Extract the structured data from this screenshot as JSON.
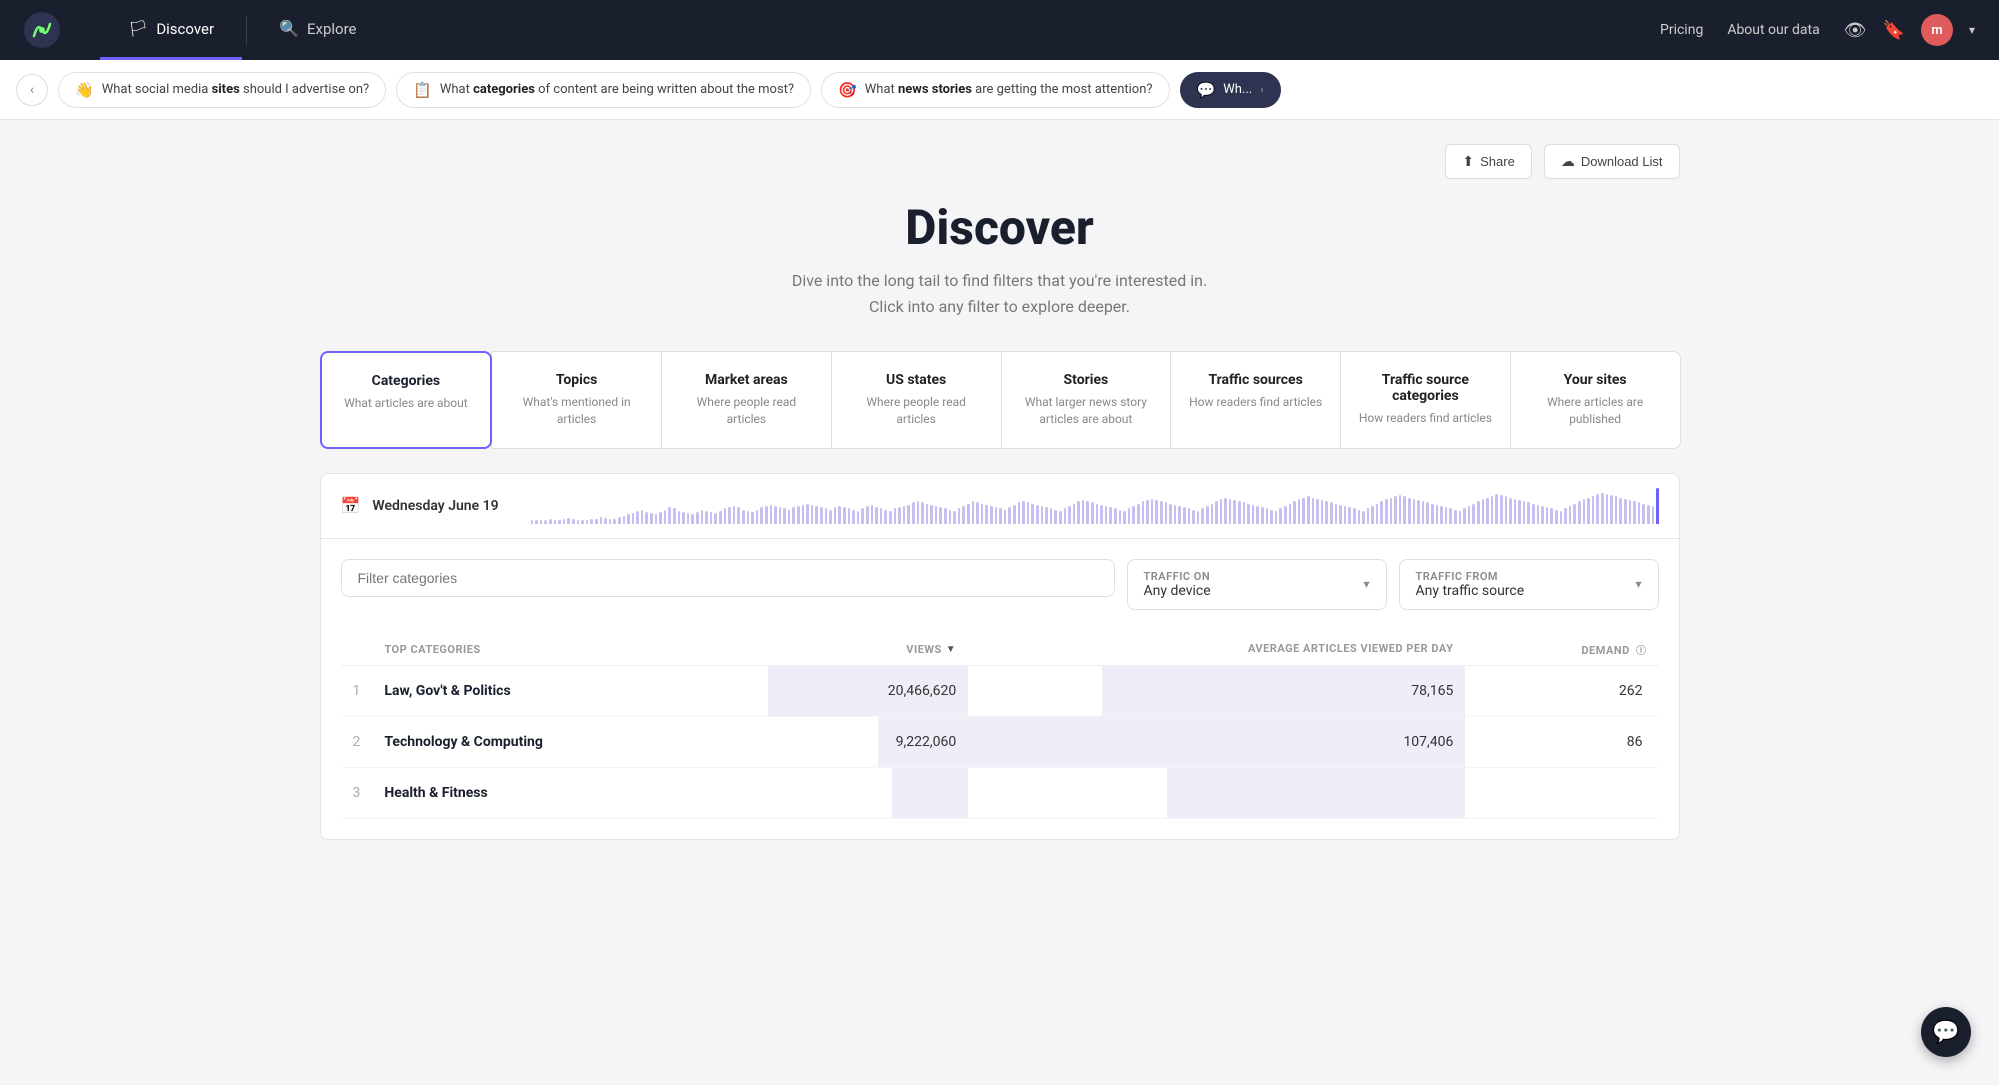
{
  "navbar": {
    "logo_alt": "Chartbeat Logo",
    "nav_items": [
      {
        "label": "Discover",
        "icon": "🏳",
        "active": true
      },
      {
        "label": "Explore",
        "icon": "🔍",
        "active": false
      }
    ],
    "right_links": [
      {
        "label": "Pricing",
        "key": "pricing"
      },
      {
        "label": "About our data",
        "key": "about"
      }
    ],
    "avatar_initial": "m"
  },
  "suggestion_bar": {
    "back_icon": "‹",
    "pills": [
      {
        "icon": "👋",
        "text_parts": [
          "What social media ",
          "sites",
          " should I advertise on?"
        ]
      },
      {
        "icon": "📋",
        "text_parts": [
          "What ",
          "categories",
          " of content are being written about the most?"
        ]
      },
      {
        "icon": "🎯",
        "text_parts": [
          "What ",
          "news stories",
          " are getting the most attention?"
        ]
      },
      {
        "icon": "💬",
        "text_parts": [
          "Wh..."
        ]
      }
    ]
  },
  "top_actions": {
    "share_label": "Share",
    "download_label": "Download List"
  },
  "page_header": {
    "title": "Discover",
    "subtitle_line1": "Dive into the long tail to find filters that you're interested in.",
    "subtitle_line2": "Click into any filter to explore deeper."
  },
  "filter_tabs": [
    {
      "title": "Categories",
      "desc": "What articles are about",
      "active": true
    },
    {
      "title": "Topics",
      "desc": "What's mentioned in articles",
      "active": false
    },
    {
      "title": "Market areas",
      "desc": "Where people read articles",
      "active": false
    },
    {
      "title": "US states",
      "desc": "Where people read articles",
      "active": false
    },
    {
      "title": "Stories",
      "desc": "What larger news story articles are about",
      "active": false
    },
    {
      "title": "Traffic sources",
      "desc": "How readers find articles",
      "active": false
    },
    {
      "title": "Traffic source categories",
      "desc": "How readers find articles",
      "active": false
    },
    {
      "title": "Your sites",
      "desc": "Where articles are published",
      "active": false
    }
  ],
  "date_bar": {
    "icon": "📅",
    "label": "Wednesday June 19"
  },
  "chart": {
    "bars": [
      4,
      6,
      5,
      7,
      8,
      6,
      5,
      9,
      10,
      8,
      7,
      6,
      5,
      8,
      9,
      11,
      10,
      9,
      8,
      12,
      14,
      16,
      18,
      22,
      24,
      20,
      18,
      16,
      20,
      24,
      28,
      26,
      22,
      20,
      18,
      16,
      20,
      24,
      22,
      20,
      18,
      22,
      26,
      28,
      30,
      28,
      24,
      22,
      20,
      24,
      28,
      30,
      32,
      30,
      28,
      26,
      24,
      28,
      30,
      32,
      34,
      32,
      30,
      28,
      26,
      24,
      28,
      30,
      28,
      26,
      24,
      22,
      26,
      30,
      32,
      28,
      26,
      24,
      22,
      26,
      28,
      30,
      32,
      36,
      38,
      36,
      34,
      32,
      30,
      28,
      26,
      24,
      22,
      26,
      30,
      34,
      38,
      36,
      34,
      32,
      30,
      28,
      26,
      24,
      28,
      32,
      36,
      38,
      36,
      34,
      32,
      30,
      28,
      26,
      24,
      22,
      26,
      30,
      34,
      38,
      40,
      38,
      36,
      34,
      32,
      30,
      28,
      26,
      24,
      22,
      26,
      30,
      34,
      38,
      40,
      42,
      40,
      38,
      36,
      34,
      32,
      30,
      28,
      26,
      24,
      22,
      26,
      30,
      34,
      38,
      42,
      44,
      42,
      40,
      38,
      36,
      34,
      32,
      30,
      28,
      26,
      24,
      22,
      26,
      30,
      34,
      38,
      42,
      44,
      46,
      44,
      42,
      40,
      38,
      36,
      34,
      32,
      30,
      28,
      26,
      24,
      22,
      26,
      30,
      34,
      38,
      42,
      44,
      46,
      48,
      46,
      44,
      42,
      40,
      38,
      36,
      34,
      32,
      30,
      28,
      26,
      24,
      22,
      26,
      30,
      34,
      38,
      42,
      44,
      46,
      50,
      48,
      46,
      44,
      42,
      40,
      38,
      36,
      34,
      32,
      30,
      28,
      26,
      24,
      22,
      26,
      30,
      34,
      38,
      42,
      44,
      46,
      50,
      52,
      50,
      48,
      46,
      44,
      42,
      40,
      38,
      36,
      34,
      32,
      30,
      60
    ]
  },
  "filters": {
    "input_placeholder": "Filter categories",
    "traffic_on_label": "TRAFFIC ON",
    "traffic_on_value": "Any device",
    "traffic_from_label": "TRAFFIC FROM",
    "traffic_from_value": "Any traffic source"
  },
  "table": {
    "headers": {
      "category": "TOP CATEGORIES",
      "views": "VIEWS",
      "avg_articles": "AVERAGE ARTICLES VIEWED PER DAY",
      "demand": "DEMAND"
    },
    "rows": [
      {
        "num": 1,
        "name": "Law, Gov't & Politics",
        "views": "20,466,620",
        "views_pct": 100,
        "avg": "78,165",
        "avg_pct": 73,
        "demand": "262"
      },
      {
        "num": 2,
        "name": "Technology & Computing",
        "views": "9,222,060",
        "views_pct": 45,
        "avg": "107,406",
        "avg_pct": 100,
        "demand": "86"
      },
      {
        "num": 3,
        "name": "Health & Fitness",
        "views": "",
        "views_pct": 38,
        "avg": "",
        "avg_pct": 60,
        "demand": ""
      }
    ]
  },
  "chat_icon": "💬"
}
